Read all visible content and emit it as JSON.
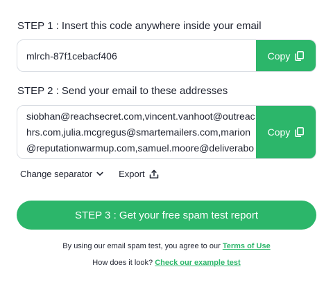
{
  "step1": {
    "label": "STEP 1 : Insert this code anywhere inside your email",
    "code": "mlrch-87f1cebacf406",
    "copy_label": "Copy"
  },
  "step2": {
    "label": "STEP 2 : Send your email to these addresses",
    "addresses": "siobhan@reachsecret.com,vincent.vanhoot@outreachrs.com,julia.mcgregus@smartemailers.com,marion@reputationwarmup.com,samuel.moore@deliveraboost.com",
    "copy_label": "Copy"
  },
  "tools": {
    "separator_label": "Change separator",
    "export_label": "Export"
  },
  "step3": {
    "label": "STEP 3 : Get your free spam test report"
  },
  "footer": {
    "terms_prefix": "By using our email spam test, you agree to our",
    "terms_link": "Terms of Use",
    "example_prefix": "How does it look?",
    "example_link": "Check our example test"
  },
  "colors": {
    "accent": "#2cb66a",
    "border": "#d9dde3",
    "text": "#1f2330"
  },
  "icons": {
    "copy": "copy-icon",
    "chevron": "chevron-down-icon",
    "export": "export-icon"
  }
}
